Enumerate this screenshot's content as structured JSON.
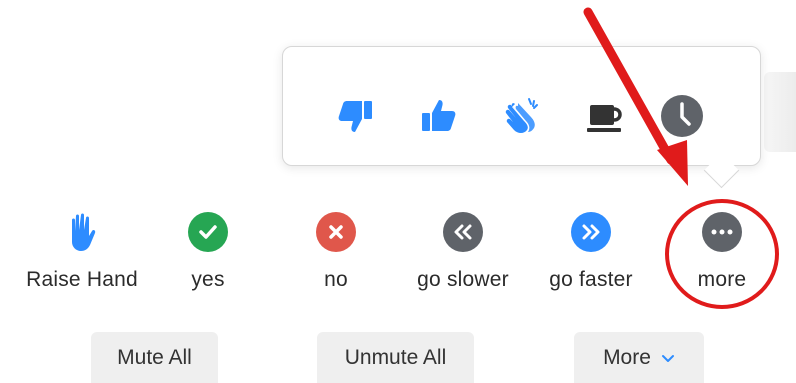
{
  "feedback": [
    {
      "label": "Raise Hand",
      "icon": "raise-hand-icon",
      "color": "#2d8cff"
    },
    {
      "label": "yes",
      "icon": "checkmark-icon",
      "color": "#26a653"
    },
    {
      "label": "no",
      "icon": "x-icon",
      "color": "#e0574b"
    },
    {
      "label": "go slower",
      "icon": "rewind-icon",
      "color": "#5f6369"
    },
    {
      "label": "go faster",
      "icon": "fast-forward-icon",
      "color": "#2d8cff"
    },
    {
      "label": "more",
      "icon": "more-dots-icon",
      "color": "#5f6369"
    }
  ],
  "reactions": [
    {
      "icon": "thumbs-down-icon",
      "color": "#2d8cff"
    },
    {
      "icon": "thumbs-up-icon",
      "color": "#2d8cff"
    },
    {
      "icon": "clapping-hands-icon",
      "color": "#2d8cff"
    },
    {
      "icon": "coffee-cup-icon",
      "color": "#333333"
    },
    {
      "icon": "clock-icon",
      "color": "#5f6369"
    }
  ],
  "buttons": {
    "mute_all": "Mute All",
    "unmute_all": "Unmute All",
    "more": "More"
  },
  "annotation": {
    "color": "#e01b1b"
  }
}
